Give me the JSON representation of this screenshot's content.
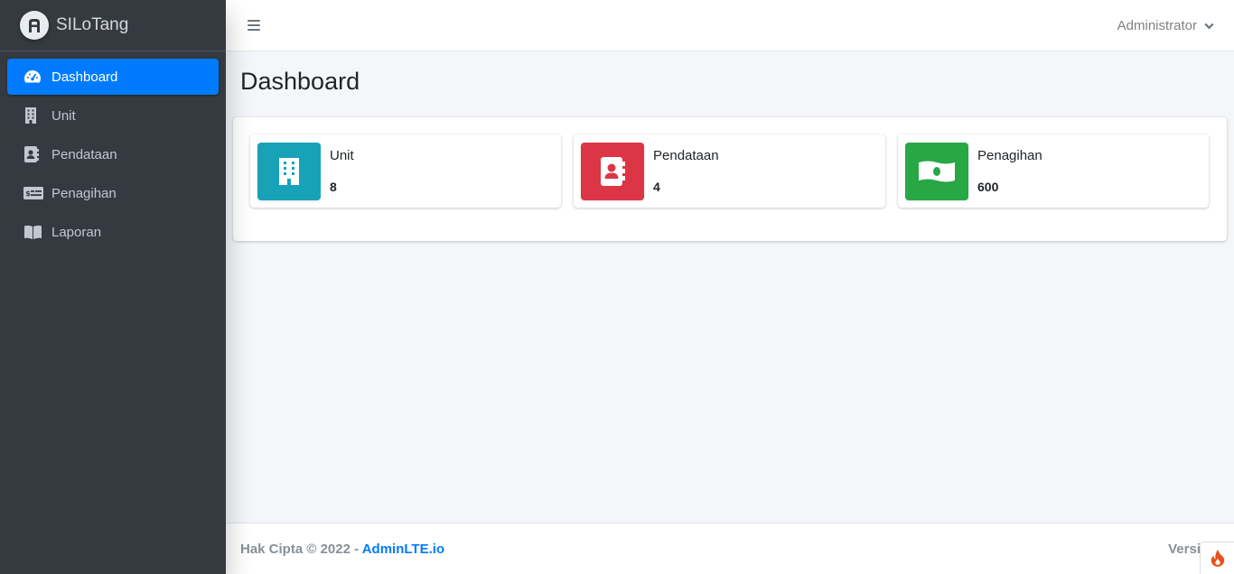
{
  "brand": {
    "name": "SILoTang",
    "logo_icon": "brand-logo-icon"
  },
  "sidebar": {
    "items": [
      {
        "label": "Dashboard",
        "icon": "tachometer-icon",
        "active": true
      },
      {
        "label": "Unit",
        "icon": "building-icon",
        "active": false
      },
      {
        "label": "Pendataan",
        "icon": "address-book-icon",
        "active": false
      },
      {
        "label": "Penagihan",
        "icon": "money-check-icon",
        "active": false
      },
      {
        "label": "Laporan",
        "icon": "book-open-icon",
        "active": false
      }
    ]
  },
  "header": {
    "menu_icon": "hamburger-icon",
    "user": "Administrator",
    "user_dropdown_icon": "chevron-down-icon"
  },
  "page": {
    "title": "Dashboard"
  },
  "info_boxes": [
    {
      "label": "Unit",
      "value": "8",
      "color": "#17a2b8",
      "icon": "building-icon"
    },
    {
      "label": "Pendataan",
      "value": "4",
      "color": "#dc3545",
      "icon": "address-book-icon"
    },
    {
      "label": "Penagihan",
      "value": "600",
      "color": "#28a745",
      "icon": "money-bill-icon"
    }
  ],
  "footer": {
    "copyright": "Hak Cipta © 2022 - ",
    "link": "AdminLTE.io",
    "version": "Versi"
  },
  "colors": {
    "sidebar_bg": "#343a40",
    "active": "#007bff",
    "link": "#007bff"
  }
}
